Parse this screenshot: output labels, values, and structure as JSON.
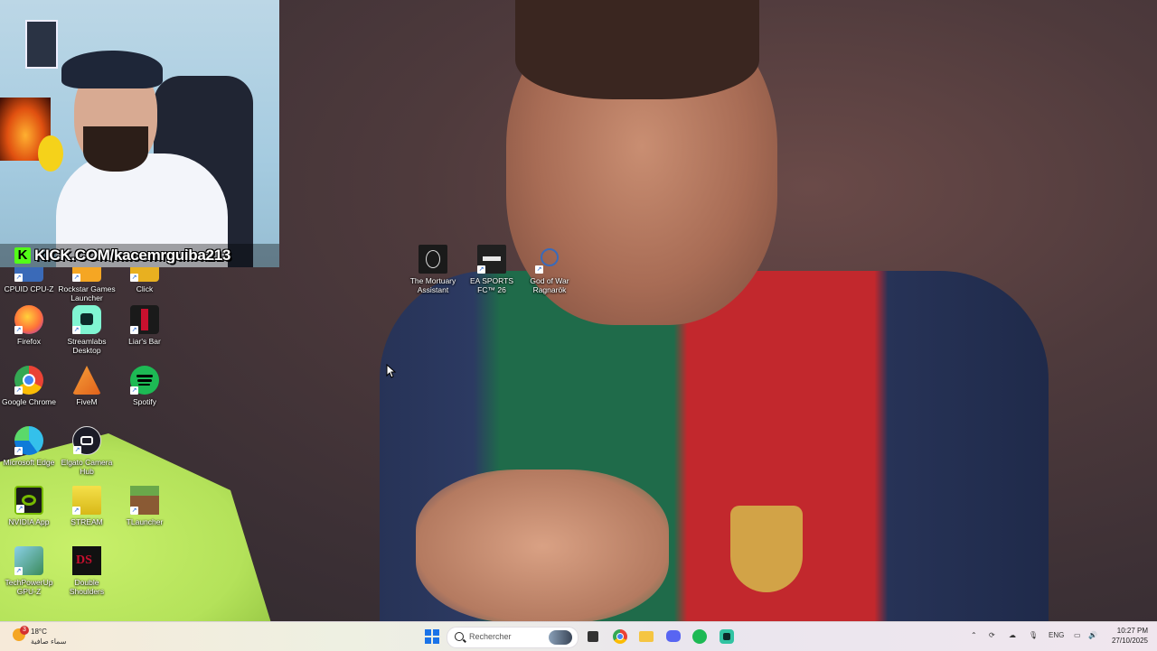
{
  "webcam": {
    "overlay_text": "KICK.COM/kacemrguiba213",
    "kick_letter": "K"
  },
  "desktop_icons": [
    {
      "label": "CPUID CPU-Z",
      "icon": "cpuz-icon",
      "color": "#3a6ab8"
    },
    {
      "label": "Rockstar Games Launcher",
      "icon": "rockstar-icon",
      "color": "#f5a623"
    },
    {
      "label": "Click",
      "icon": "click-icon",
      "color": "#e8b020"
    },
    {
      "label": "Firefox",
      "icon": "firefox-icon",
      "color": "#ff7139"
    },
    {
      "label": "Streamlabs Desktop",
      "icon": "streamlabs-icon",
      "color": "#80f5d2"
    },
    {
      "label": "Liar's Bar",
      "icon": "liars-bar-icon",
      "color": "#1a1a1a"
    },
    {
      "label": "Google Chrome",
      "icon": "chrome-icon",
      "color": "#4285f4"
    },
    {
      "label": "FiveM",
      "icon": "fivem-icon",
      "color": "#f28c28"
    },
    {
      "label": "Spotify",
      "icon": "spotify-icon",
      "color": "#1db954"
    },
    {
      "label": "Microsoft Edge",
      "icon": "edge-icon",
      "color": "#0f7bd8"
    },
    {
      "label": "Elgato Camera Hub",
      "icon": "elgato-camera-icon",
      "color": "#1c1c28"
    },
    {
      "label": "NVIDIA App",
      "icon": "nvidia-icon",
      "color": "#76b900"
    },
    {
      "label": "STREAM",
      "icon": "stream-icon",
      "color": "#e8d020"
    },
    {
      "label": "TLauncher",
      "icon": "tlauncher-icon",
      "color": "#5a8a3a"
    },
    {
      "label": "TechPowerUp GPU-Z",
      "icon": "gpuz-icon",
      "color": "#3aa0c8"
    },
    {
      "label": "Double Shoulders",
      "icon": "double-shoulders-icon",
      "color": "#c8102e"
    },
    {
      "label": "The Mortuary Assistant",
      "icon": "mortuary-icon",
      "color": "#1a1a1a"
    },
    {
      "label": "EA SPORTS FC™ 26",
      "icon": "ea-fc-icon",
      "color": "#202020"
    },
    {
      "label": "God of War Ragnarök",
      "icon": "god-of-war-icon",
      "color": "#3a6ab8"
    }
  ],
  "taskbar": {
    "weather_temp": "18°C",
    "weather_condition": "سماء صافية",
    "weather_badge": "3",
    "search_placeholder": "Rechercher",
    "language": "ENG",
    "time": "10:27 PM",
    "date": "27/10/2025",
    "pinned": [
      {
        "icon": "windows-start-icon",
        "color": "#1a73e8"
      },
      {
        "icon": "file-manager-icon",
        "color": "#333333"
      },
      {
        "icon": "chrome-icon",
        "color": "#4285f4"
      },
      {
        "icon": "folder-icon",
        "color": "#f5c542"
      },
      {
        "icon": "discord-icon",
        "color": "#5865f2"
      },
      {
        "icon": "spotify-icon",
        "color": "#1db954"
      },
      {
        "icon": "streamlabs-icon",
        "color": "#31c3a2"
      }
    ]
  }
}
